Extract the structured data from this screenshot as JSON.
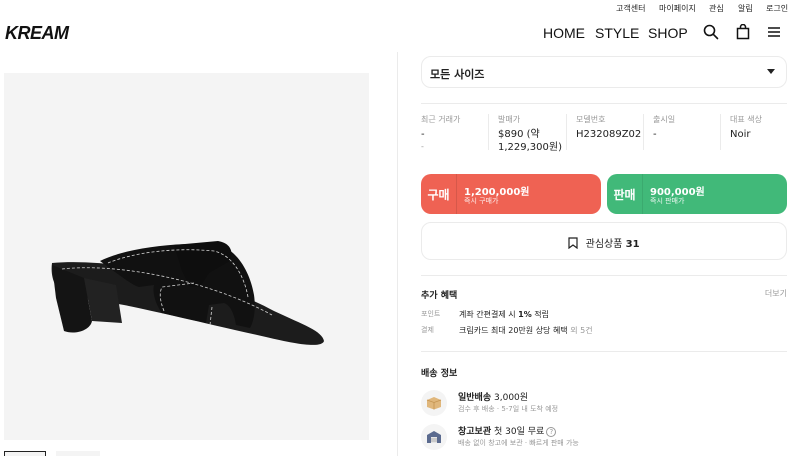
{
  "util_links": [
    "고객센터",
    "마이페이지",
    "관심",
    "알림",
    "로그인"
  ],
  "brand": "KREAM",
  "nav": [
    "HOME",
    "STYLE",
    "SHOP"
  ],
  "size_select": {
    "label": "모든 사이즈"
  },
  "product_info": [
    {
      "key": "최근 거래가",
      "value": "-",
      "sub": "-"
    },
    {
      "key": "발매가",
      "value_line1": "$890 (약",
      "value_line2": "1,229,300원)"
    },
    {
      "key": "모델번호",
      "value": "H232089Z02"
    },
    {
      "key": "출시일",
      "value": "-"
    },
    {
      "key": "대표 색상",
      "value": "Noir"
    }
  ],
  "buy": {
    "label": "구매",
    "price": "1,200,000원",
    "sub": "즉시 구매가",
    "color": "#ef6253"
  },
  "sell": {
    "label": "판매",
    "price": "900,000원",
    "sub": "즉시 판매가",
    "color": "#41b979"
  },
  "wishlist": {
    "label": "관심상품",
    "count": "31"
  },
  "benefits": {
    "title": "추가 혜택",
    "more": "더보기",
    "rows": [
      {
        "key": "포인트",
        "text": "계좌 간편결제 시",
        "highlight": "1%",
        "suffix": "적립"
      },
      {
        "key": "결제",
        "text": "크림카드 최대 20만원 상당 혜택",
        "muted": "외 5건"
      }
    ]
  },
  "shipping": {
    "title": "배송 정보",
    "options": [
      {
        "name": "일반배송",
        "price": "3,000원",
        "desc": "검수 후 배송 · 5-7일 내 도착 예정"
      },
      {
        "name": "창고보관",
        "price": "첫 30일 무료",
        "help": "?",
        "desc": "배송 없이 창고에 보관 · 빠르게 판매 가능"
      }
    ]
  }
}
